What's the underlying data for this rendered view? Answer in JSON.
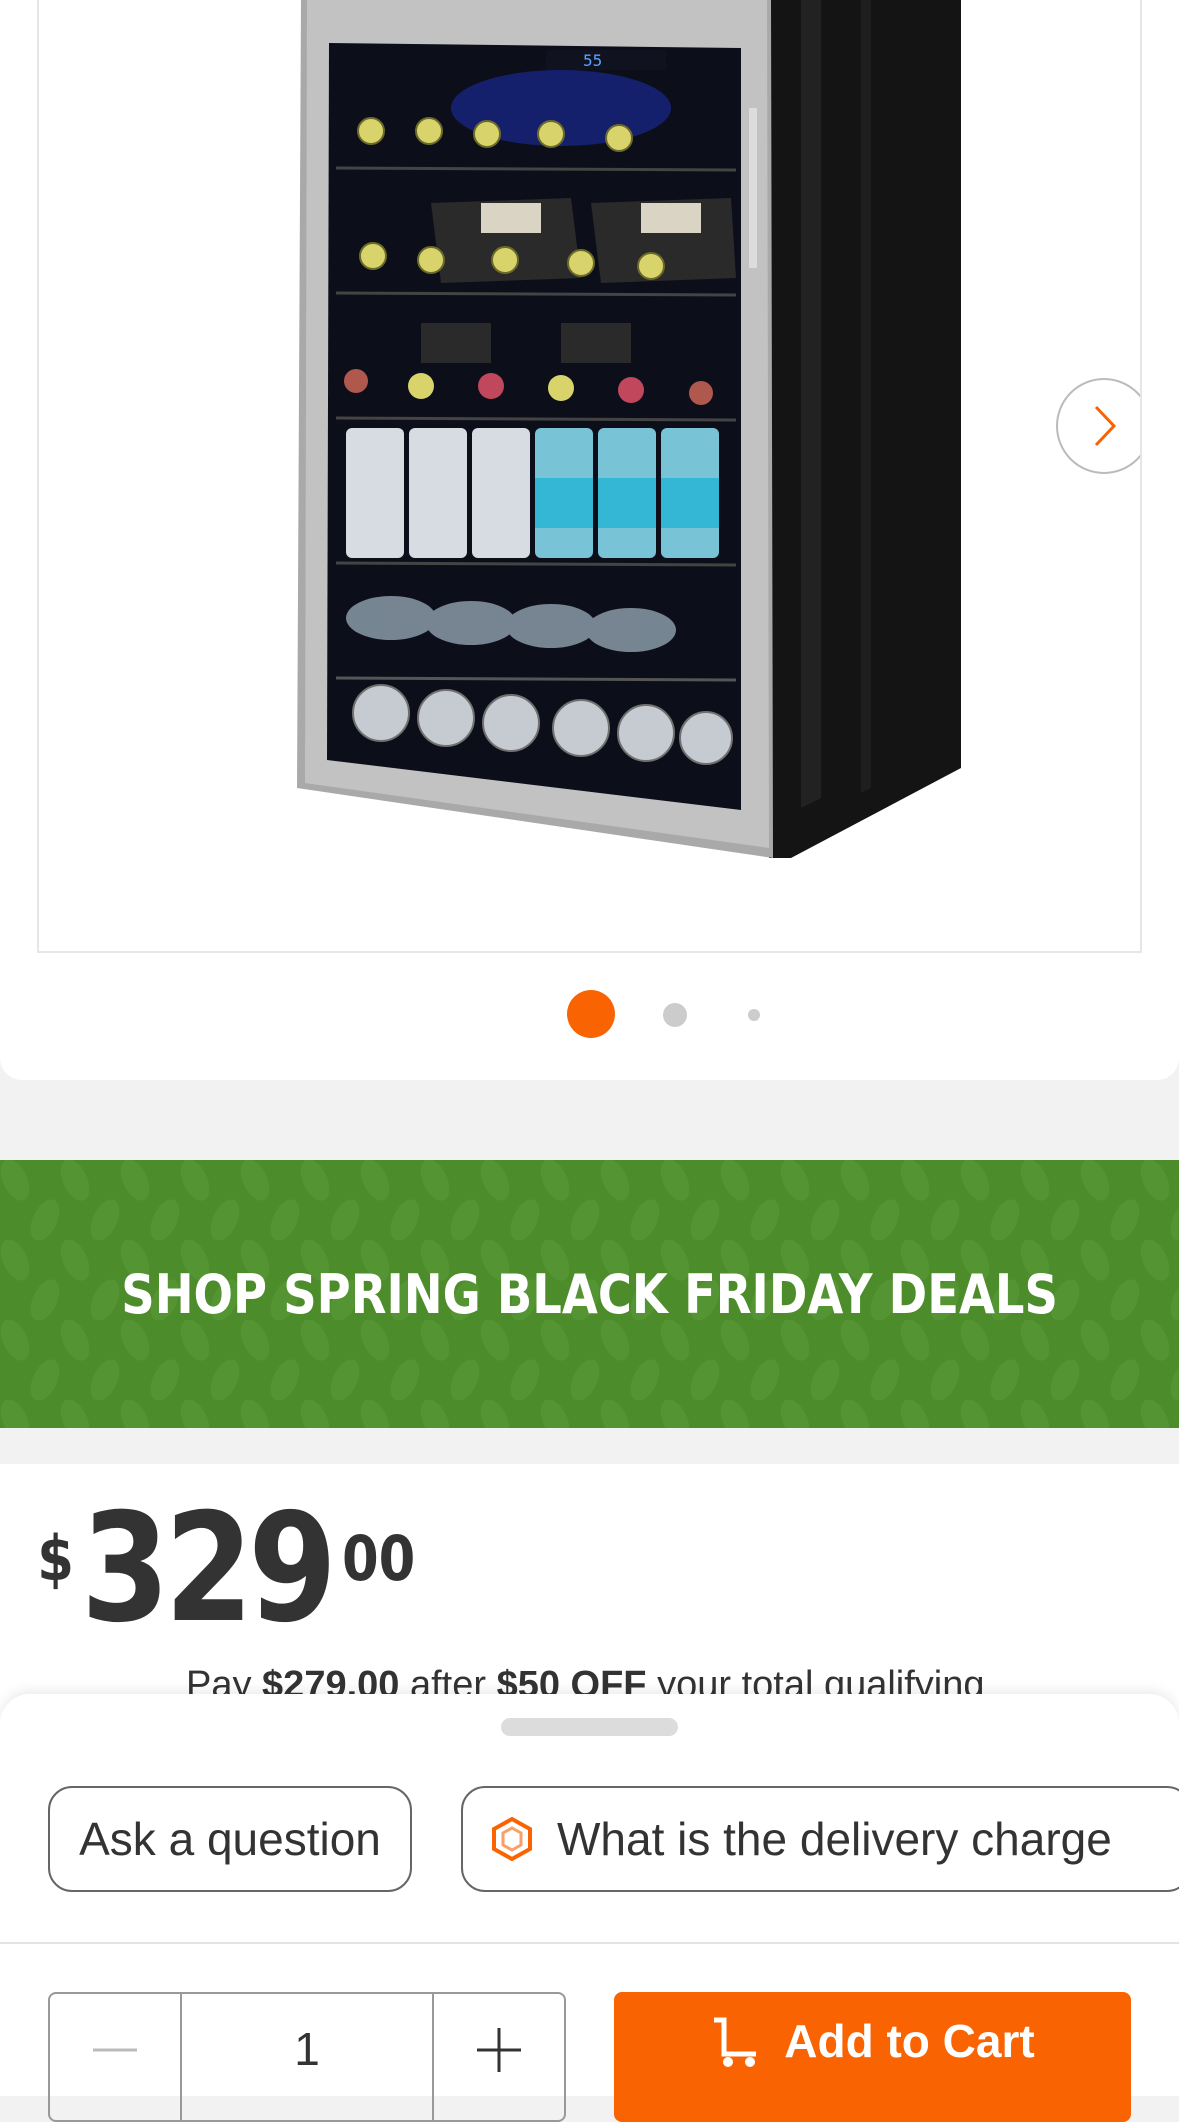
{
  "gallery": {
    "image_alt": "Beverage and wine cooler with glass door",
    "thermostat_display": "55",
    "next_icon": "chevron-right-icon",
    "dots": [
      {
        "active": true
      },
      {
        "active": false
      },
      {
        "active": false
      }
    ]
  },
  "promo_banner": {
    "text": "SHOP SPRING BLACK FRIDAY DEALS",
    "color": "#4c8c2b"
  },
  "price": {
    "currency": "$",
    "dollars": "329",
    "cents": "00",
    "offer_prefix": "Pay ",
    "offer_price": "$279.00",
    "offer_mid": " after ",
    "offer_discount": "$50 OFF",
    "offer_suffix": " your total qualifying"
  },
  "chips": {
    "ask_label": "Ask a question",
    "delivery_label": "What is the delivery charge",
    "delivery_icon": "hexagon-assistant-icon"
  },
  "purchase": {
    "quantity": "1",
    "decrease_icon": "minus-icon",
    "increase_icon": "plus-icon",
    "cart_label": "Add to Cart",
    "cart_icon": "cart-icon",
    "accent_color": "#f96302"
  }
}
